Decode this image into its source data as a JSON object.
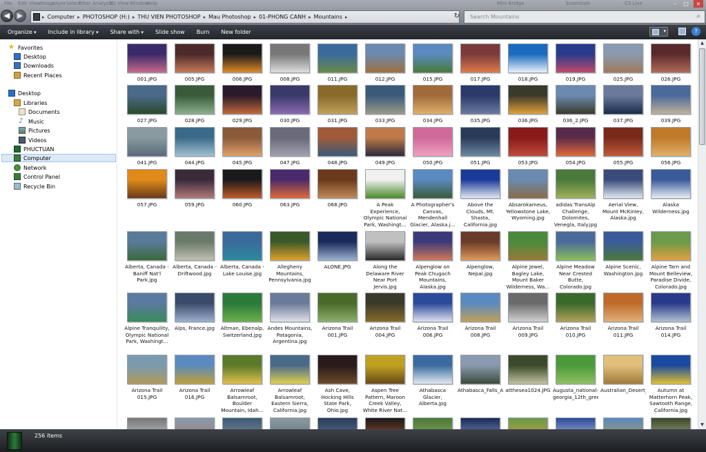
{
  "titlebar": {
    "ghost_menu": [
      "File",
      "Edit",
      "View",
      "Image",
      "Layer",
      "Select",
      "Filter",
      "Analysis",
      "3D",
      "View",
      "Window",
      "Help"
    ],
    "ghost_buttons": [
      "Mini Bridge",
      "Essentials",
      "CS Live"
    ]
  },
  "address": {
    "crumbs": [
      "Computer",
      "PHOTOSHOP (H:)",
      "THU VIEN PHOTOSHOP",
      "Mau Photoshop",
      "01-PHONG CANH",
      "Mountains"
    ]
  },
  "search": {
    "placeholder": "Search Mountains"
  },
  "toolbar": {
    "items": [
      "Organize",
      "Include in library",
      "Share with",
      "Slide show",
      "Burn",
      "New folder"
    ]
  },
  "nav": {
    "favorites": "Favorites",
    "fav_items": [
      "Desktop",
      "Downloads",
      "Recent Places"
    ],
    "desktop": "Desktop",
    "libraries": "Libraries",
    "lib_items": [
      "Documents",
      "Music",
      "Pictures",
      "Videos"
    ],
    "tree_items": [
      "PHUCTUAN",
      "Computer",
      "Network",
      "Control Panel",
      "Recycle Bin"
    ]
  },
  "files": [
    "001.JPG",
    "005.JPG",
    "006.JPG",
    "008.JPG",
    "011.JPG",
    "012.JPG",
    "015.JPG",
    "017.JPG",
    "018.JPG",
    "019.JPG",
    "025.JPG",
    "026.JPG",
    "027.JPG",
    "028.JPG",
    "029.JPG",
    "030.JPG",
    "031.JPG",
    "033.JPG",
    "034.JPG",
    "035.JPG",
    "036.JPG",
    "036_2.JPG",
    "037.JPG",
    "039.JPG",
    "041.JPG",
    "044.JPG",
    "045.JPG",
    "047.JPG",
    "048.JPG",
    "049.JPG",
    "050.JPG",
    "051.JPG",
    "053.JPG",
    "054.JPG",
    "055.JPG",
    "056.JPG",
    "057.JPG",
    "059.JPG",
    "060.JPG",
    "063.JPG",
    "068.JPG",
    "A Peak Experience, Olympic National Park, Washingt...",
    "A Photographer's Canvas, Mendenhall Glacier, Alaska.j...",
    "Above the Clouds, Mt. Shasta, California.jpg",
    "Absarokameus, Yellowstone Lake, Wyoming.jpg",
    "adidas TransAlp Challenge, Dolomites, Venegla, Italy.jpg",
    "Aerial View, Mount McKinley, Alaska.jpg",
    "Alaska Wilderness.jpg",
    "Alberta, Canada - Baniff Nat'l Park.jpg",
    "Alberta, Canada - Driftwood.jpg",
    "Alberta, Canada - Lake Louise.jpg",
    "Allegheny Mountains, Pennsylvania.jpg",
    "ALONE.JPG",
    "Along the Delaware River Near Port Jervis.jpg",
    "Alpenglow on Peak Chugach Mountains, Alaska.jpg",
    "Alpenglow, Nepal.jpg",
    "Alpine Jewel, Bagley Lake, Mount Baker Wilderness, Wa...",
    "Alpine Meadow Near Crested Butte, Colorado.jpg",
    "Alpine Scenic, Washington.jpg",
    "Alpine Tarn and Mount Belleview, Paradise Divide, Colorado.jpg",
    "Alpine Tranquility, Olympic National Park, Washingt...",
    "Alps, France.jpg",
    "Altman, Ebenalp, Switzerland.jpg",
    "Andes Mountains, Patagonia, Argentina.jpg",
    "Arizona Trail 001.JPG",
    "Arizona Trail 004.JPG",
    "Arizona Trail 006.JPG",
    "Arizona Trail 008.JPG",
    "Arizona Trail 009.JPG",
    "Arizona Trail 010.JPG",
    "Arizona Trail 011.JPG",
    "Arizona Trail 014.JPG",
    "Arizona Trail 015.JPG",
    "Arizona Trail 016.JPG",
    "Arrowleaf Balsamroot, Boulder Mountain, Idah...",
    "Arrowleaf Balsamroot, Eastern Sierra, California.jpg",
    "Ash Cave, Hocking Hills State Park, Ohio.jpg",
    "Aspen Tree Pattern, Maroon Creek Valley, White River Nat...",
    "Athabasca Glacier, Alberta.jpg",
    "Athabasca_Falls_Alberta_Canada.jpg",
    "atthesea1024.JPG",
    "Augusta_national-georgia_12th_green.jpg",
    "Australian_Desert_1.jpg",
    "Autumn at Matterhorn Peak, Sawtooth Range, California.jpg"
  ],
  "status": {
    "count": "256 items"
  }
}
